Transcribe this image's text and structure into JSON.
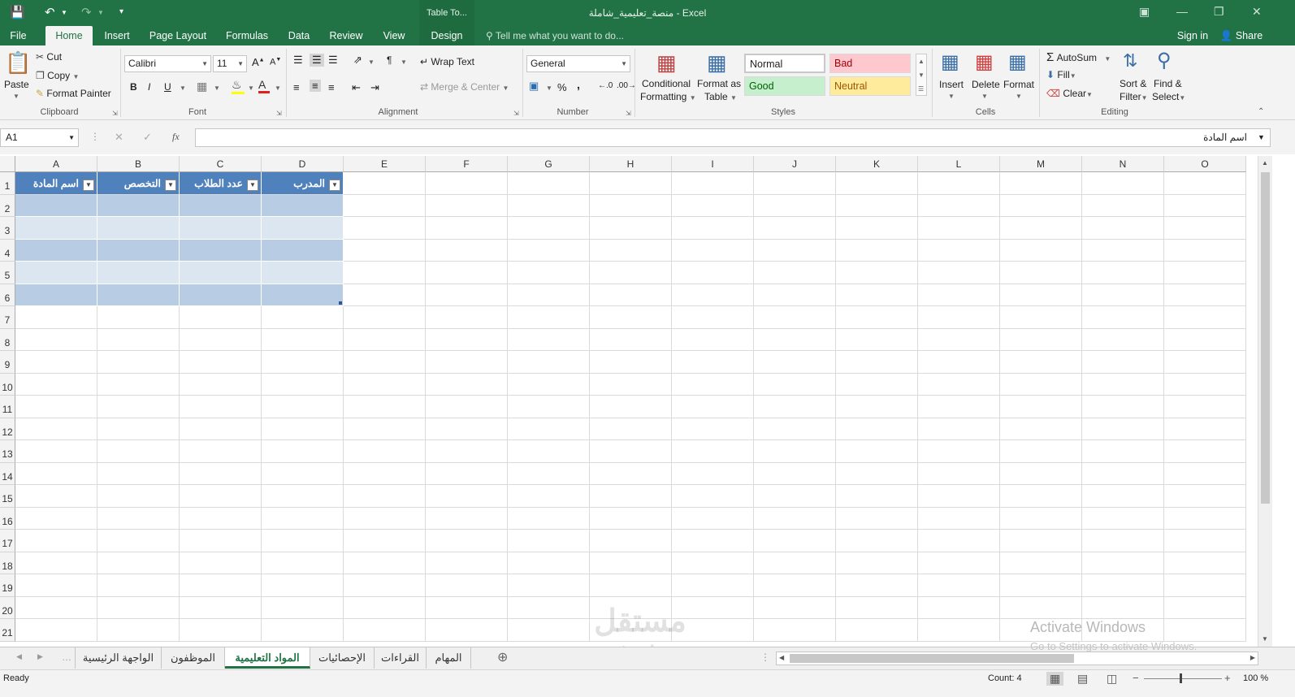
{
  "window": {
    "title": "منصة_تعليمية_شاملة - Excel",
    "context_tab_title": "Table To..."
  },
  "ribbon_tabs": [
    "File",
    "Home",
    "Insert",
    "Page Layout",
    "Formulas",
    "Data",
    "Review",
    "View",
    "Design"
  ],
  "tell_me": "Tell me what you want to do...",
  "account": {
    "sign_in": "Sign in",
    "share": "Share"
  },
  "clipboard": {
    "paste": "Paste",
    "cut": "Cut",
    "copy": "Copy",
    "format_painter": "Format Painter",
    "label": "Clipboard"
  },
  "font": {
    "name": "Calibri",
    "size": "11",
    "bold": "B",
    "italic": "I",
    "underline": "U",
    "label": "Font"
  },
  "alignment": {
    "wrap_text": "Wrap Text",
    "merge_center": "Merge & Center",
    "label": "Alignment"
  },
  "number": {
    "format": "General",
    "percent": "%",
    "comma": ",",
    "label": "Number"
  },
  "styles": {
    "conditional_1": "Conditional",
    "conditional_2": "Formatting",
    "format_as_1": "Format as",
    "format_as_2": "Table",
    "normal": "Normal",
    "bad": "Bad",
    "good": "Good",
    "neutral": "Neutral",
    "label": "Styles"
  },
  "cells": {
    "insert": "Insert",
    "delete": "Delete",
    "format": "Format",
    "label": "Cells"
  },
  "editing": {
    "autosum": "AutoSum",
    "fill": "Fill",
    "clear": "Clear",
    "sort_1": "Sort &",
    "sort_2": "Filter",
    "find_1": "Find &",
    "find_2": "Select",
    "label": "Editing"
  },
  "formula_bar": {
    "name_box": "A1",
    "fx": "fx",
    "content": "اسم المادة"
  },
  "columns": [
    "A",
    "B",
    "C",
    "D",
    "E",
    "F",
    "G",
    "H",
    "I",
    "J",
    "K",
    "L",
    "M",
    "N",
    "O"
  ],
  "rows": [
    "1",
    "2",
    "3",
    "4",
    "5",
    "6",
    "7",
    "8",
    "9",
    "10",
    "11",
    "12",
    "13",
    "14",
    "15",
    "16",
    "17",
    "18",
    "19",
    "20",
    "21"
  ],
  "table": {
    "headers": [
      "اسم المادة",
      "التخصص",
      "عدد الطلاب",
      "المدرب"
    ],
    "band_colors": {
      "header": "#4f81bd",
      "dark": "#b8cce4",
      "light": "#dce6f1"
    }
  },
  "sheet_tabs": [
    "الواجهة الرئيسية",
    "الموظفون",
    "المواد التعليمية",
    "الإحصائيات",
    "القراءات",
    "المهام"
  ],
  "active_sheet": "المواد التعليمية",
  "status": {
    "ready": "Ready",
    "count": "Count: 4",
    "zoom": "100 %"
  },
  "watermark": {
    "activate": "Activate Windows",
    "goto": "Go to Settings to activate Windows.",
    "logo_ar": "مستقل",
    "logo_en": "mostaql.com"
  },
  "colors": {
    "accent": "#217346"
  }
}
